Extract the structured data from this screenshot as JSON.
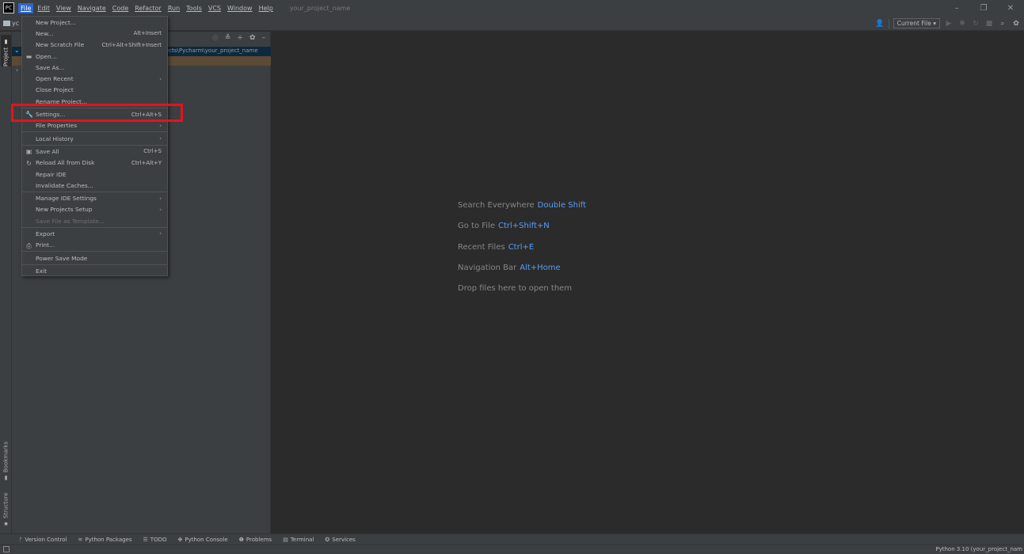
{
  "menubar": {
    "logo": "PC",
    "items": [
      "File",
      "Edit",
      "View",
      "Navigate",
      "Code",
      "Refactor",
      "Run",
      "Tools",
      "VCS",
      "Window",
      "Help"
    ],
    "project_title": "your_project_name"
  },
  "window_controls": {
    "minimize": "–",
    "restore": "❐",
    "close": "✕"
  },
  "navbar": {
    "crumb": "yc",
    "run_config": "Current File ▾"
  },
  "left_stripe": {
    "project": "Project",
    "bookmarks": "Bookmarks",
    "structure": "Structure"
  },
  "project_panel": {
    "path_fragment": "ects\\Pycharm\\your_project_name"
  },
  "file_menu": {
    "new_project": "New Project...",
    "new": "New...",
    "new_shortcut": "Alt+Insert",
    "new_scratch": "New Scratch File",
    "new_scratch_shortcut": "Ctrl+Alt+Shift+Insert",
    "open": "Open...",
    "save_as": "Save As...",
    "open_recent": "Open Recent",
    "close_project": "Close Project",
    "rename_project": "Rename Project...",
    "settings": "Settings...",
    "settings_shortcut": "Ctrl+Alt+S",
    "file_properties": "File Properties",
    "local_history": "Local History",
    "save_all": "Save All",
    "save_all_shortcut": "Ctrl+S",
    "reload_all": "Reload All from Disk",
    "reload_all_shortcut": "Ctrl+Alt+Y",
    "repair_ide": "Repair IDE",
    "invalidate_caches": "Invalidate Caches...",
    "manage_ide_settings": "Manage IDE Settings",
    "new_projects_setup": "New Projects Setup",
    "save_as_template": "Save File as Template...",
    "export": "Export",
    "print": "Print...",
    "power_save": "Power Save Mode",
    "exit": "Exit"
  },
  "editor_hints": [
    {
      "label": "Search Everywhere",
      "key": "Double Shift"
    },
    {
      "label": "Go to File",
      "key": "Ctrl+Shift+N"
    },
    {
      "label": "Recent Files",
      "key": "Ctrl+E"
    },
    {
      "label": "Navigation Bar",
      "key": "Alt+Home"
    },
    {
      "label": "Drop files here to open them",
      "key": ""
    }
  ],
  "bottom_bar": {
    "version_control": "Version Control",
    "python_packages": "Python Packages",
    "todo": "TODO",
    "python_console": "Python Console",
    "problems": "Problems",
    "terminal": "Terminal",
    "services": "Services"
  },
  "status_bar": {
    "interpreter": "Python 3.10 (your_project_nam"
  }
}
